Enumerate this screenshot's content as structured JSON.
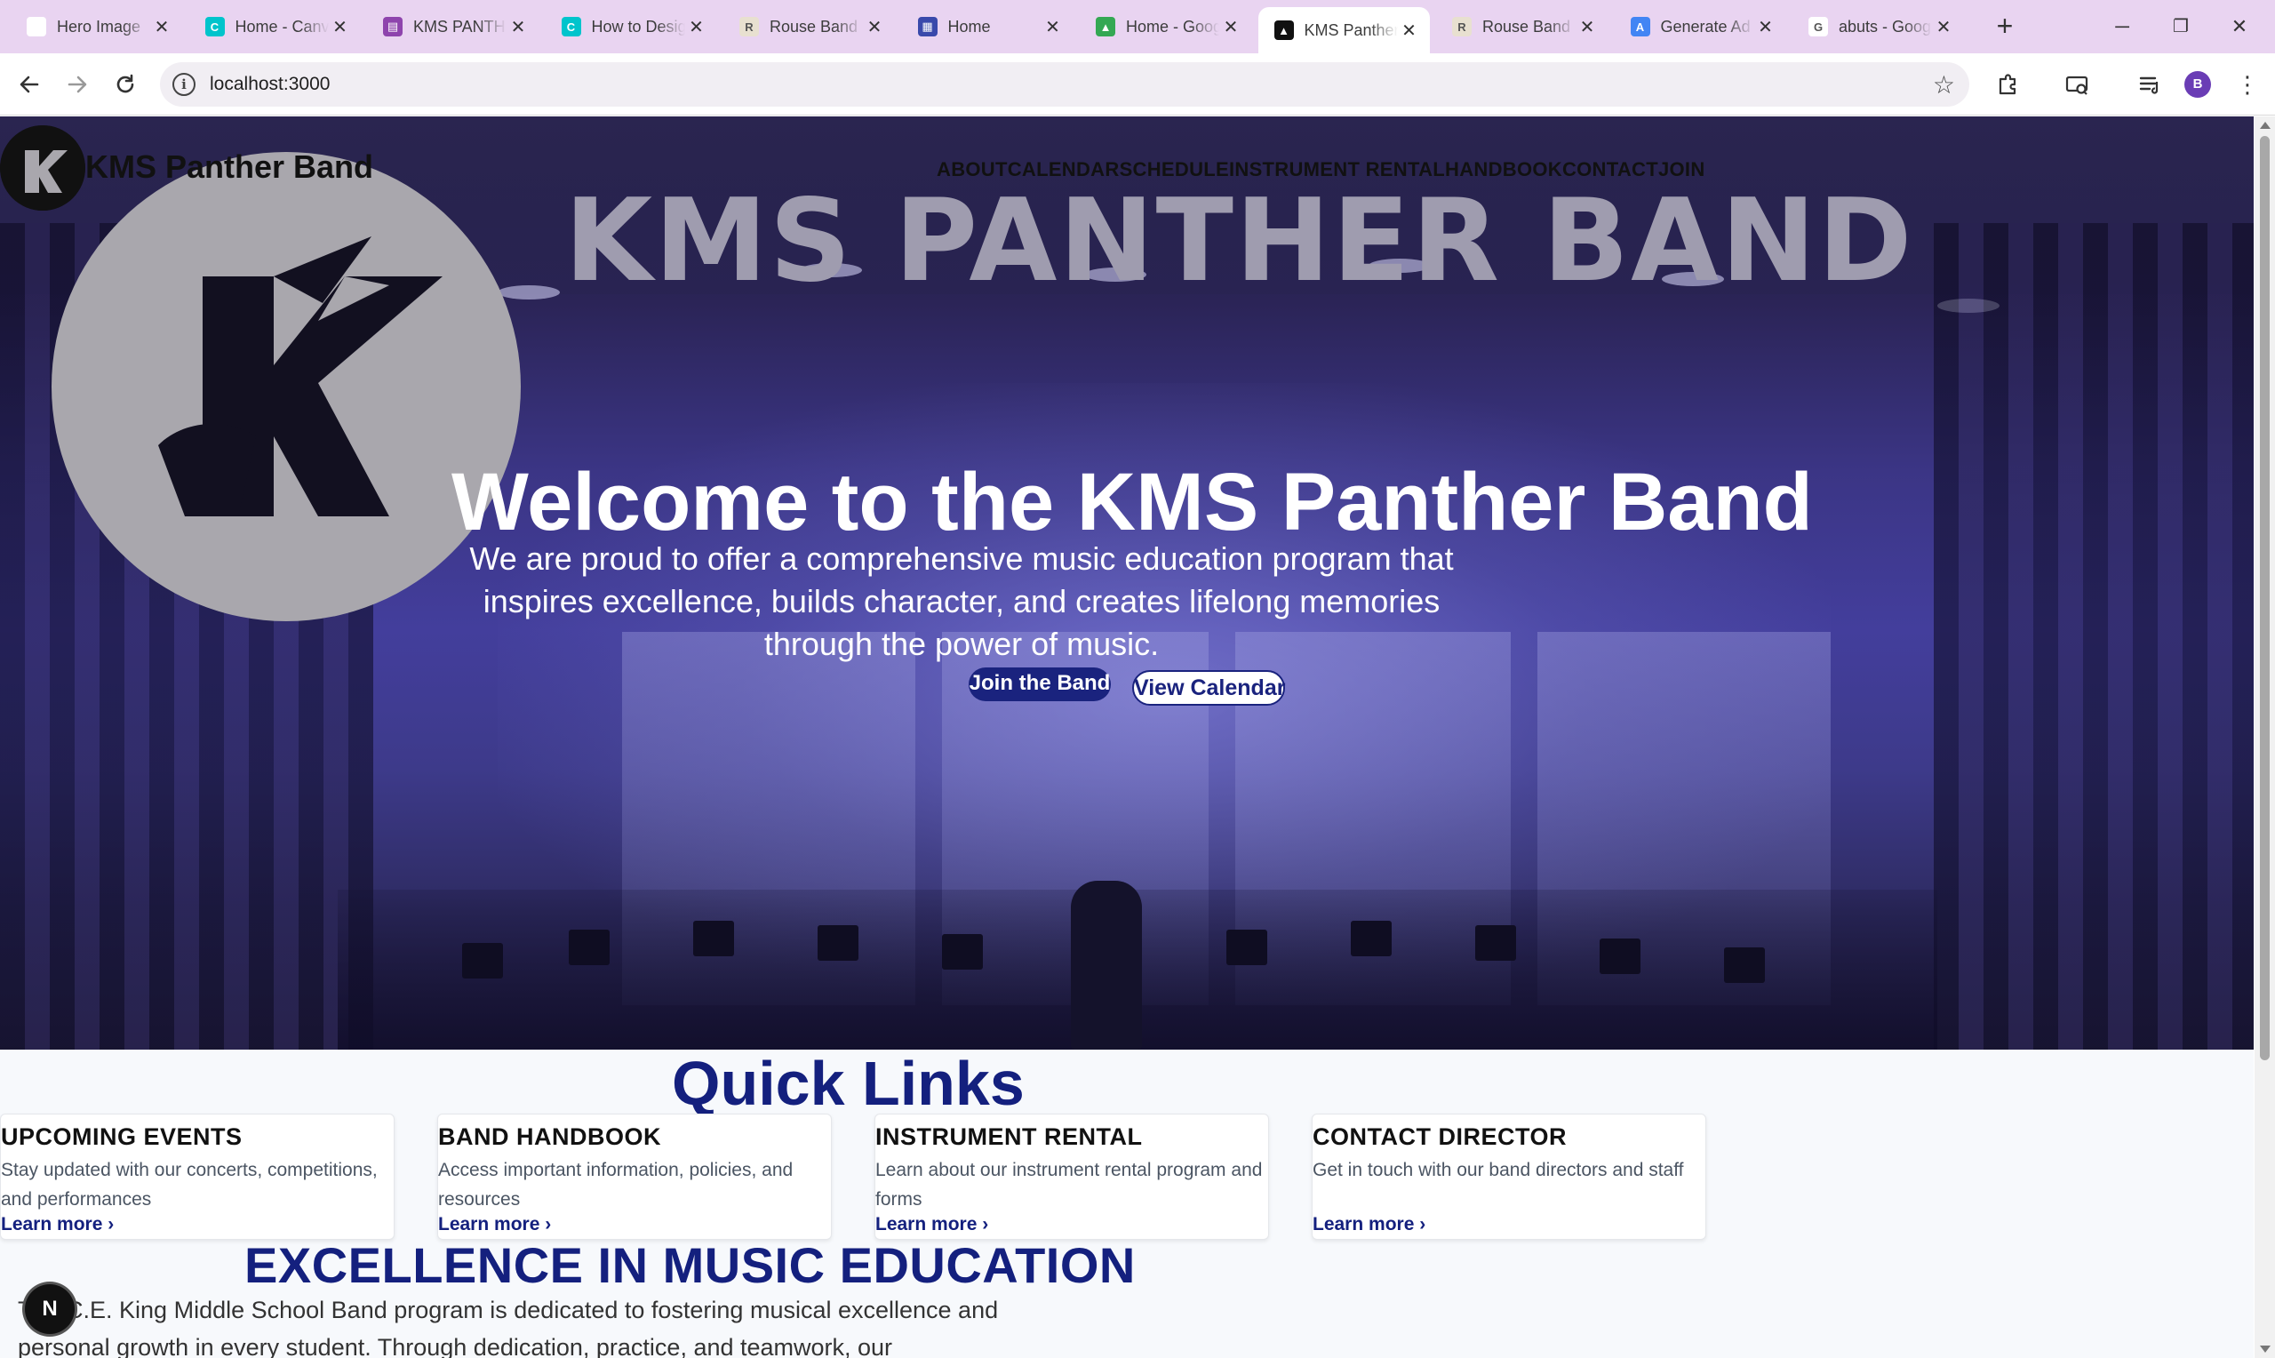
{
  "browser": {
    "tabs": [
      {
        "title": "Hero Image",
        "favicon_color": "#ffffff",
        "favicon_glyph": "",
        "active": false
      },
      {
        "title": "Home - Canva",
        "favicon_color": "#00c4cc",
        "favicon_glyph": "C",
        "active": false
      },
      {
        "title": "KMS PANTHER BAND",
        "favicon_color": "#8e44ad",
        "favicon_glyph": "▤",
        "active": false
      },
      {
        "title": "How to Design",
        "favicon_color": "#00c4cc",
        "favicon_glyph": "C",
        "active": false
      },
      {
        "title": "Rouse Band",
        "favicon_color": "#e8e0d0",
        "favicon_glyph": "R",
        "active": false
      },
      {
        "title": "Home",
        "favicon_color": "#3949ab",
        "favicon_glyph": "▦",
        "active": false
      },
      {
        "title": "Home - Google Drive",
        "favicon_color": "#34a853",
        "favicon_glyph": "▲",
        "active": false
      },
      {
        "title": "KMS Panther Band",
        "favicon_color": "#111111",
        "favicon_glyph": "▲",
        "active": true
      },
      {
        "title": "Rouse Band",
        "favicon_color": "#e8e0d0",
        "favicon_glyph": "R",
        "active": false
      },
      {
        "title": "Generate Ad",
        "favicon_color": "#4285f4",
        "favicon_glyph": "A",
        "active": false
      },
      {
        "title": "abuts - Google",
        "favicon_color": "#ffffff",
        "favicon_glyph": "G",
        "active": false
      }
    ],
    "url": "localhost:3000",
    "profile_initial": "B",
    "icons": {
      "back": "back-arrow-icon",
      "forward": "forward-arrow-icon",
      "reload": "reload-icon",
      "site_info": "site-info-icon",
      "bookmark": "star-icon",
      "extensions": "puzzle-icon",
      "media": "media-control-icon",
      "reading_list": "reading-list-icon",
      "menu": "kebab-menu-icon"
    }
  },
  "site": {
    "brand": "KMS Panther Band",
    "banner_text": "KMS PANTHER BAND",
    "nav": [
      "ABOUT",
      "CALENDAR",
      "SCHEDULE",
      "INSTRUMENT RENTAL",
      "HANDBOOK",
      "CONTACT",
      "JOIN"
    ],
    "hero": {
      "title": "Welcome to the KMS Panther Band",
      "subtitle": "We are proud to offer a comprehensive music education program that inspires excellence, builds character, and creates lifelong memories through the power of music.",
      "primary_button": "Join the Band",
      "secondary_button": "View Calendar"
    },
    "quick_links": {
      "heading": "Quick Links",
      "cards": [
        {
          "title": "UPCOMING EVENTS",
          "description": "Stay updated with our concerts, competitions, and performances",
          "link": "Learn more"
        },
        {
          "title": "BAND HANDBOOK",
          "description": "Access important information, policies, and resources",
          "link": "Learn more"
        },
        {
          "title": "INSTRUMENT RENTAL",
          "description": "Learn about our instrument rental program and forms",
          "link": "Learn more"
        },
        {
          "title": "CONTACT DIRECTOR",
          "description": "Get in touch with our band directors and staff",
          "link": "Learn more"
        }
      ]
    },
    "excellence": {
      "heading": "EXCELLENCE IN MUSIC EDUCATION",
      "body": "The C.E. King Middle School Band program is dedicated to fostering musical excellence and personal growth in every student. Through dedication, practice, and teamwork, our"
    },
    "dev_badge": "N"
  },
  "colors": {
    "brand_navy": "#14207e",
    "tabbar": "#e9d4f1",
    "hero_overlay": "#433e9c"
  }
}
